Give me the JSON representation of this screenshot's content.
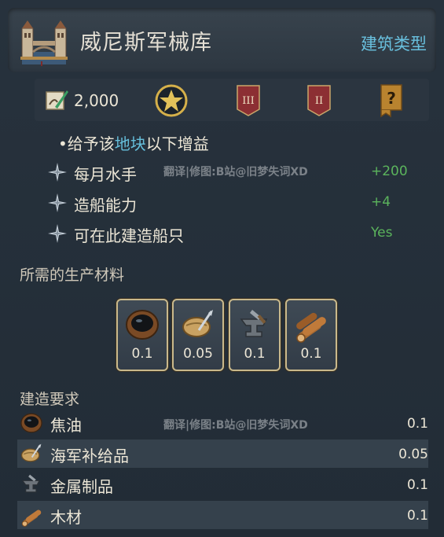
{
  "header": {
    "title": "威尼斯军械库",
    "type_link": "建筑类型",
    "icon": "venetian-arsenal-building-icon"
  },
  "stats": {
    "cost_icon": "quill-document-icon",
    "cost": "2,000",
    "icons": [
      "gold-star-icon",
      "level-III-banner-icon",
      "level-II-banner-icon",
      "question-scroll-icon"
    ],
    "badge_labels": [
      "III",
      "II",
      "?"
    ]
  },
  "bonus": {
    "prefix": "•给予该",
    "highlight": "地块",
    "suffix": "以下增益",
    "rows": [
      {
        "label": "每月水手",
        "value": "+200"
      },
      {
        "label": "造船能力",
        "value": "+4"
      },
      {
        "label": "可在此建造船只",
        "value": "Yes"
      }
    ]
  },
  "watermark": "翻译|修图:B站@旧梦失词XD",
  "materials": {
    "title": "所需的生产材料",
    "items": [
      {
        "icon": "tar-bowl-icon",
        "amount": "0.1"
      },
      {
        "icon": "naval-supplies-icon",
        "amount": "0.05"
      },
      {
        "icon": "anvil-metal-icon",
        "amount": "0.1"
      },
      {
        "icon": "wood-logs-icon",
        "amount": "0.1"
      }
    ]
  },
  "requirements": {
    "title": "建造要求",
    "rows": [
      {
        "icon": "tar-bowl-icon",
        "label": "焦油",
        "value": "0.1"
      },
      {
        "icon": "naval-supplies-icon",
        "label": "海军补给品",
        "value": "0.05"
      },
      {
        "icon": "anvil-metal-icon",
        "label": "金属制品",
        "value": "0.1"
      },
      {
        "icon": "wood-logs-icon",
        "label": "木材",
        "value": "0.1"
      }
    ]
  },
  "colors": {
    "accent_link": "#69c0de",
    "positive": "#5bb45c",
    "card_border": "#c9b98c",
    "banner_red": "#8c2f33"
  }
}
